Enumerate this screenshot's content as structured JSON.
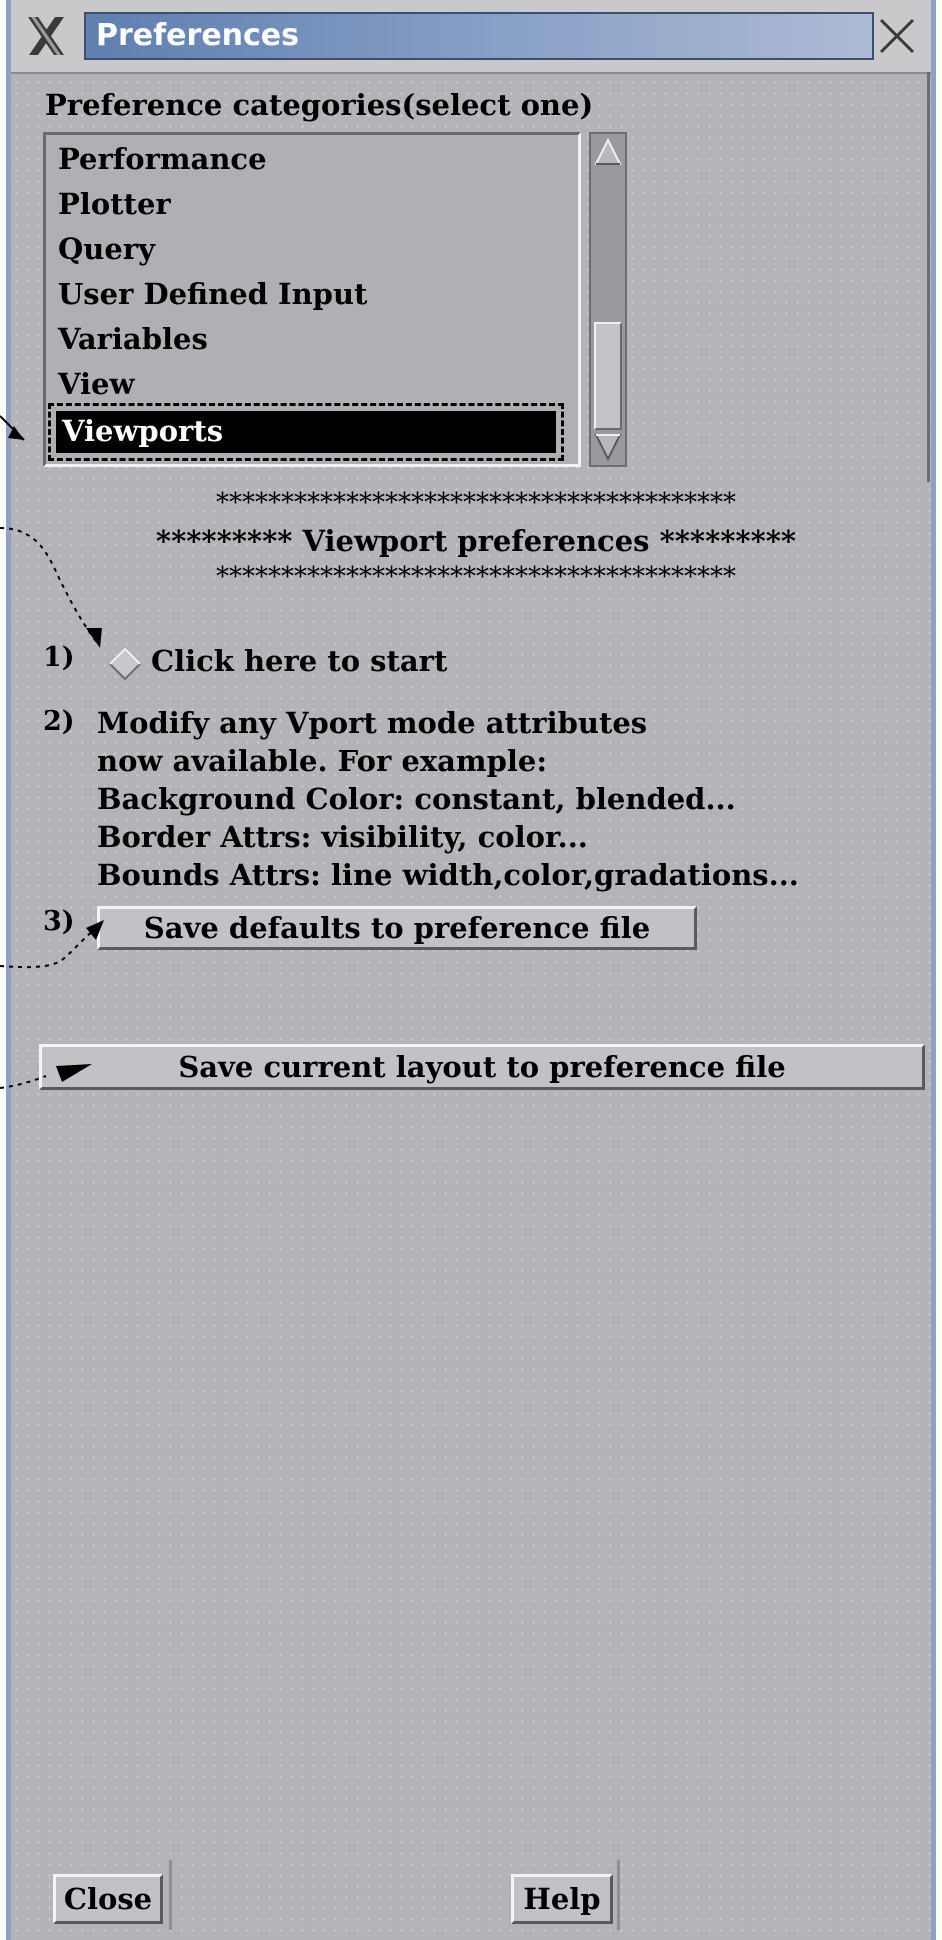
{
  "window": {
    "title": "Preferences",
    "app_icon": "x-logo-icon",
    "close_icon": "close-icon"
  },
  "categories": {
    "heading": "Preference categories(select one)",
    "items": [
      {
        "label": "Performance"
      },
      {
        "label": "Plotter"
      },
      {
        "label": "Query"
      },
      {
        "label": "User Defined Input"
      },
      {
        "label": "Variables"
      },
      {
        "label": "View"
      },
      {
        "label": "Viewports",
        "selected": true
      }
    ],
    "selected_label": "Viewports"
  },
  "section": {
    "stars_top": "****************************************",
    "title": "********* Viewport preferences *********",
    "stars_bottom": "****************************************"
  },
  "steps": {
    "step1_num": "1)",
    "step1_label": "Click here to start",
    "step2_num": "2)",
    "step2_lines": [
      "Modify any Vport mode attributes",
      "now available. For example:",
      "Background Color: constant, blended...",
      "Border Attrs: visibility, color...",
      "Bounds Attrs: line width,color,gradations..."
    ],
    "step3_num": "3)",
    "save_defaults_label": "Save defaults to preference file"
  },
  "save_layout_label": "Save current layout to preference file",
  "footer": {
    "close_label": "Close",
    "help_label": "Help"
  },
  "colors": {
    "panel": "#b4b4b8",
    "title_bar": "#6f8cbc",
    "selection": "#000000"
  }
}
